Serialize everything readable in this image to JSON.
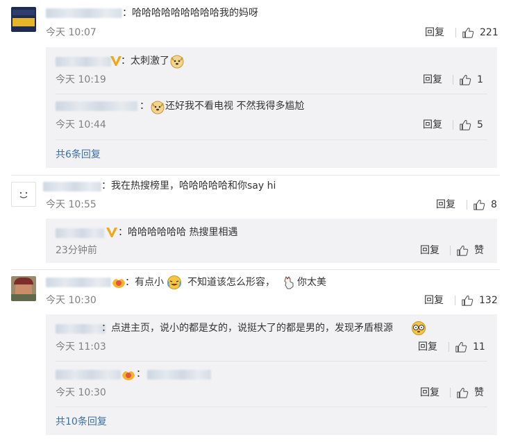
{
  "comments": [
    {
      "text": "：哈哈哈哈哈哈哈哈哈我的妈呀",
      "time": "今天 10:07",
      "reply_label": "回复",
      "likes": "221",
      "replies": [
        {
          "text": "：太刺激了",
          "time": "今天 10:19",
          "reply_label": "回复",
          "likes": "1"
        },
        {
          "text": "还好我不看电视 不然我得多尴尬",
          "time": "今天 10:44",
          "reply_label": "回复",
          "likes": "5"
        }
      ],
      "more_label": "共6条回复"
    },
    {
      "text": "：我在热搜榜里，哈哈哈哈哈和你say hi",
      "time": "今天 10:55",
      "reply_label": "回复",
      "likes": "8",
      "replies": [
        {
          "text": "：哈哈哈哈哈哈 热搜里相遇",
          "time": "23分钟前",
          "reply_label": "回复",
          "likes": "赞"
        }
      ]
    },
    {
      "text_a": "：有点小",
      "text_b": "不知道该怎么形容，",
      "text_c": "你太美",
      "time": "今天 10:30",
      "reply_label": "回复",
      "likes": "132",
      "replies": [
        {
          "text": "：点进主页，说小的都是女的，说挺大了的都是男的，发现矛盾根源",
          "time": "今天 11:03",
          "reply_label": "回复",
          "likes": "11"
        },
        {
          "text": "：",
          "time": "今天 10:30",
          "reply_label": "回复",
          "likes": "赞"
        }
      ],
      "more_label": "共10条回复"
    }
  ]
}
